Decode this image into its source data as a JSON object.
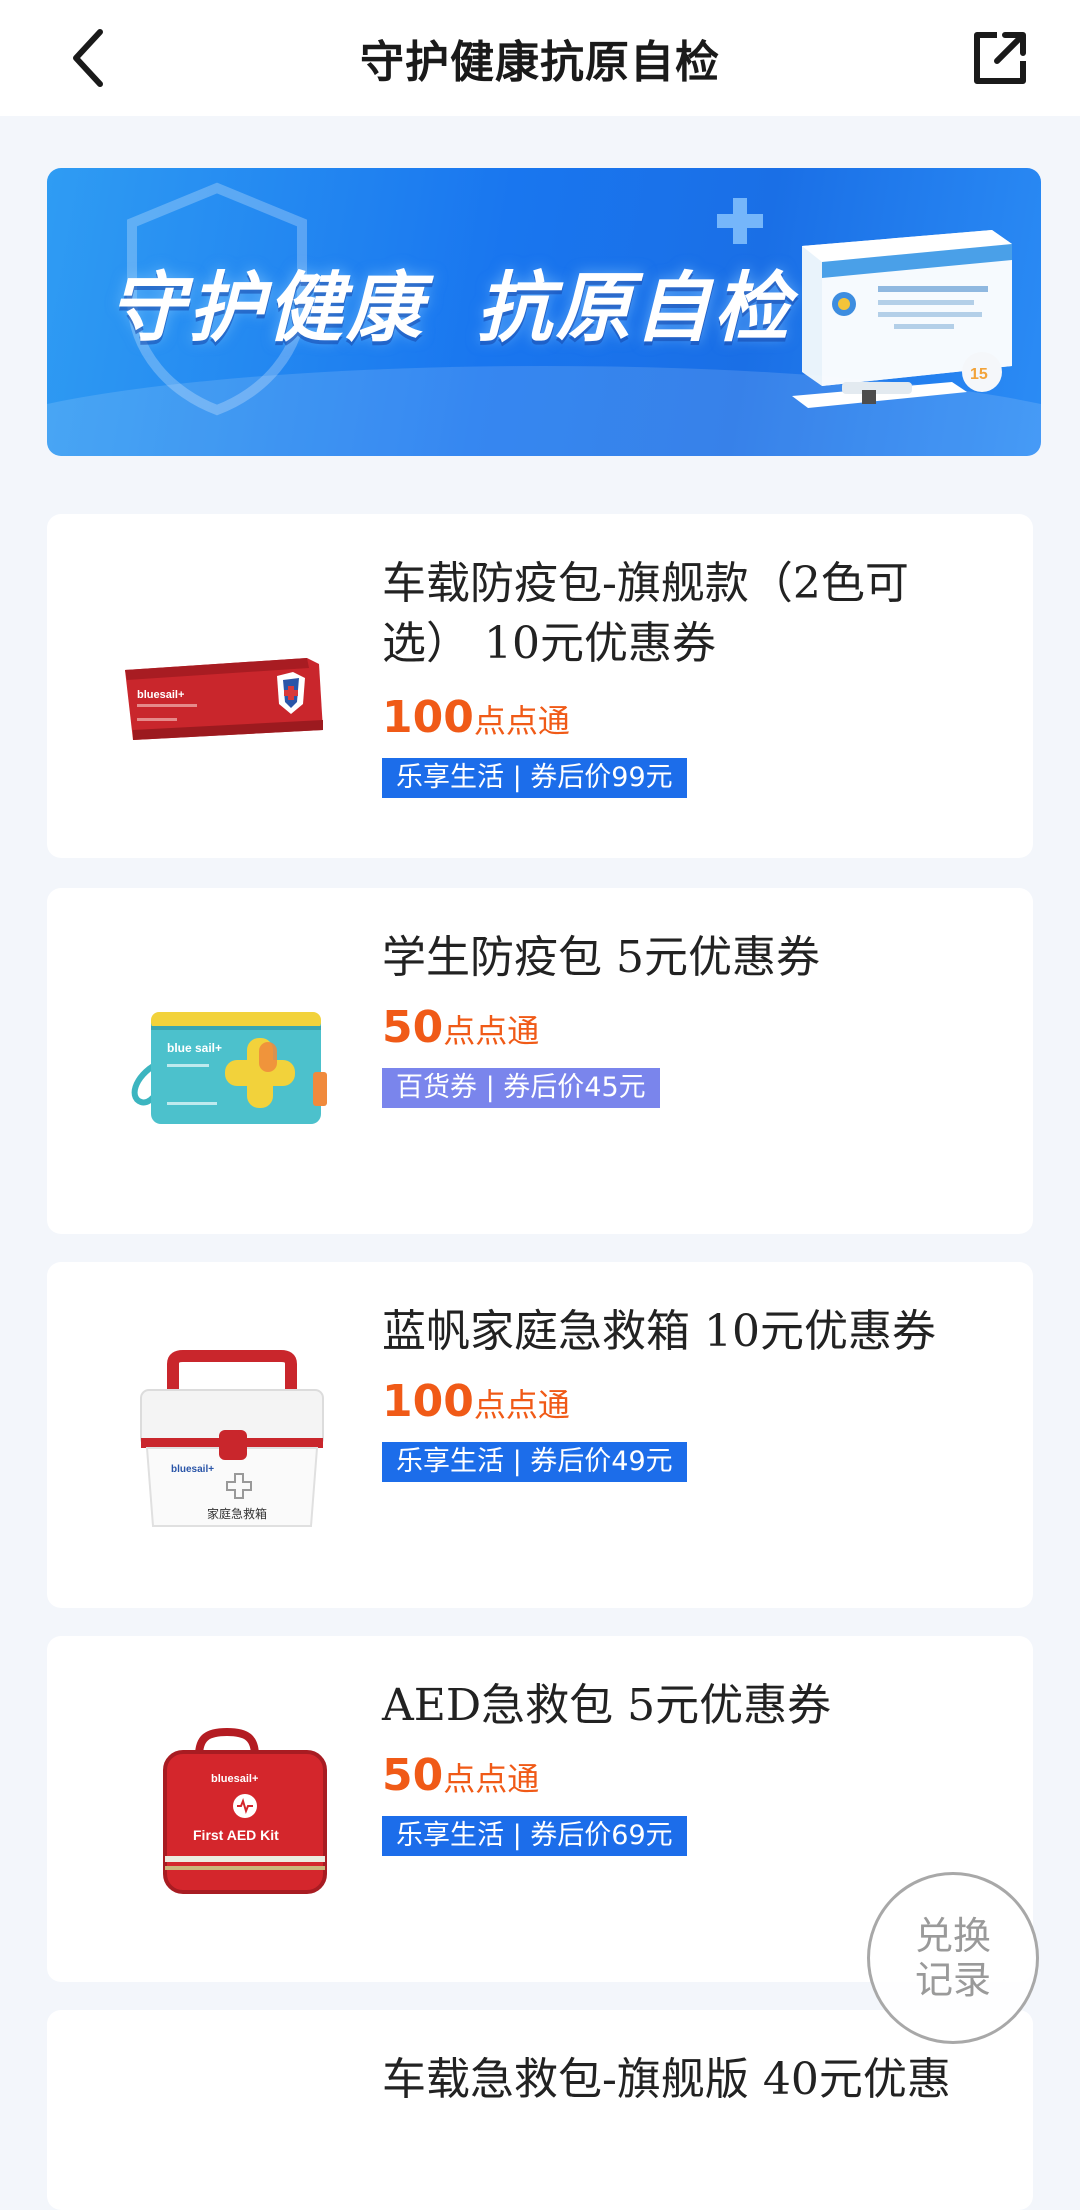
{
  "header": {
    "title": "守护健康抗原自检",
    "back_icon": "chevron-left-icon",
    "share_icon": "share-external-icon"
  },
  "banner": {
    "headline": "守护健康  抗原自检",
    "colors": {
      "gradient_start": "#2f9cf3",
      "gradient_end": "#1a6fe6"
    }
  },
  "products": [
    {
      "name": "车载防疫包-旗舰款（2色可选） 10元优惠券",
      "points": "100",
      "points_unit": "点点通",
      "tag": "乐享生活 | 券后价99元",
      "tag_color": "#1c6dea",
      "image": "red-pouch-image"
    },
    {
      "name": "学生防疫包 5元优惠券",
      "points": "50",
      "points_unit": "点点通",
      "tag": "百货券 | 券后价45元",
      "tag_color": "#7a85ec",
      "image": "teal-pouch-image"
    },
    {
      "name": "蓝帆家庭急救箱 10元优惠券",
      "points": "100",
      "points_unit": "点点通",
      "tag": "乐享生活 | 券后价49元",
      "tag_color": "#1c6dea",
      "image": "first-aid-box-image"
    },
    {
      "name": "AED急救包 5元优惠券",
      "points": "50",
      "points_unit": "点点通",
      "tag": "乐享生活 | 券后价69元",
      "tag_color": "#1c6dea",
      "image": "aed-bag-image"
    },
    {
      "name": "车载急救包-旗舰版 40元优惠"
    }
  ],
  "image_text": {
    "pouch_brand": "bluesail+",
    "student_brand": "blue sail+",
    "box_brand": "bluesail+",
    "box_label": "家庭急救箱",
    "aed_label": "First AED Kit"
  },
  "fab": {
    "label": "兑换记录"
  },
  "colors": {
    "accent_orange": "#f05a17",
    "tag_blue": "#1c6dea",
    "tag_purple": "#7a85ec",
    "page_bg": "#f3f6fb"
  }
}
